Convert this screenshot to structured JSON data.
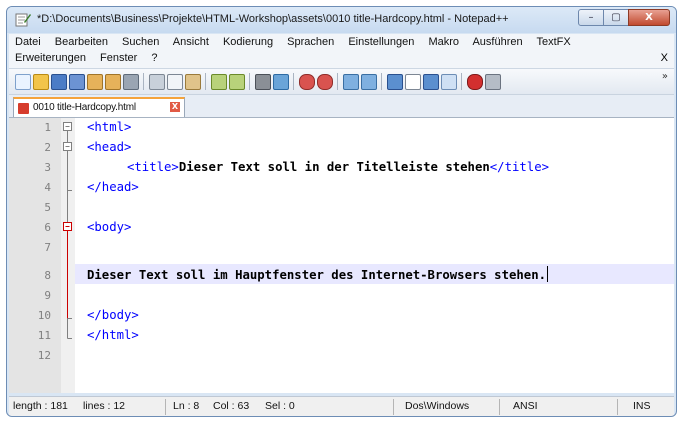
{
  "window": {
    "title": "*D:\\Documents\\Business\\Projekte\\HTML-Workshop\\assets\\0010 title-Hardcopy.html - Notepad++",
    "controls": {
      "minimize": "–",
      "maximize": "▢",
      "close": "X"
    }
  },
  "menu": {
    "row1": [
      "Datei",
      "Bearbeiten",
      "Suchen",
      "Ansicht",
      "Kodierung",
      "Sprachen",
      "Einstellungen",
      "Makro",
      "Ausführen",
      "TextFX"
    ],
    "row2": [
      "Erweiterungen",
      "Fenster",
      "?"
    ],
    "close_doc": "X"
  },
  "toolbar": {
    "overflow": "»"
  },
  "tabs": [
    {
      "label": "0010 title-Hardcopy.html",
      "modified": true,
      "close": "X"
    }
  ],
  "editor": {
    "line_numbers": [
      "1",
      "2",
      "3",
      "4",
      "5",
      "6",
      "7",
      "8",
      "9",
      "10",
      "11",
      "12"
    ],
    "lines": {
      "l1": "<html>",
      "l2": "<head>",
      "l3_open": "<title>",
      "l3_text": "Dieser Text soll in der Titelleiste stehen",
      "l3_close": "</title>",
      "l4": "</head>",
      "l6": "<body>",
      "l8": "Dieser Text soll im Hauptfenster des Internet-Browsers stehen.",
      "l10": "</body>",
      "l11": "</html>"
    },
    "current_line": 8
  },
  "status": {
    "length": "length : 181",
    "lines": "lines : 12",
    "ln": "Ln : 8",
    "col": "Col : 63",
    "sel": "Sel : 0",
    "eol": "Dos\\Windows",
    "encoding": "ANSI",
    "mode": "INS"
  },
  "colors": {
    "tag": "#0000ff",
    "fold_marker": "#cc0000",
    "current_line": "#e8e8ff",
    "tab_accent": "#f5a33b"
  }
}
